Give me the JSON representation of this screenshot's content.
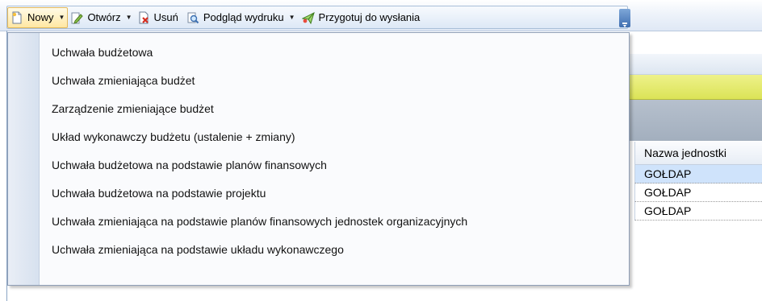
{
  "toolbar": {
    "buttons": [
      {
        "label": "Nowy",
        "icon": "new-document-icon",
        "has_dropdown": true
      },
      {
        "label": "Otwórz",
        "icon": "edit-document-icon",
        "has_dropdown": true
      },
      {
        "label": "Usuń",
        "icon": "delete-document-icon",
        "has_dropdown": false
      },
      {
        "label": "Podgląd wydruku",
        "icon": "print-preview-icon",
        "has_dropdown": true
      },
      {
        "label": "Przygotuj do wysłania",
        "icon": "send-prepare-icon",
        "has_dropdown": false
      }
    ]
  },
  "menu": {
    "items": [
      {
        "label": "Uchwała budżetowa"
      },
      {
        "label": "Uchwała zmieniająca budżet"
      },
      {
        "label": "Zarządzenie zmieniające budżet"
      },
      {
        "label": "Układ wykonawczy budżetu (ustalenie + zmiany)"
      },
      {
        "label": "Uchwała budżetowa na podstawie planów finansowych"
      },
      {
        "label": "Uchwała budżetowa na podstawie projektu"
      },
      {
        "label": "Uchwała zmieniająca na podstawie planów finansowych jednostek organizacyjnych"
      },
      {
        "label": "Uchwała zmieniająca na podstawie układu wykonawczego"
      }
    ]
  },
  "grid": {
    "column_header": "Nazwa jednostki",
    "rows": [
      {
        "value": "GOŁDAP",
        "selected": true
      },
      {
        "value": "GOŁDAP",
        "selected": false
      },
      {
        "value": "GOŁDAP",
        "selected": false
      }
    ]
  },
  "colors": {
    "highlight_band": "#e4ea6f",
    "header_band": "#aab5c3",
    "selected_row": "#cfe3fb"
  }
}
